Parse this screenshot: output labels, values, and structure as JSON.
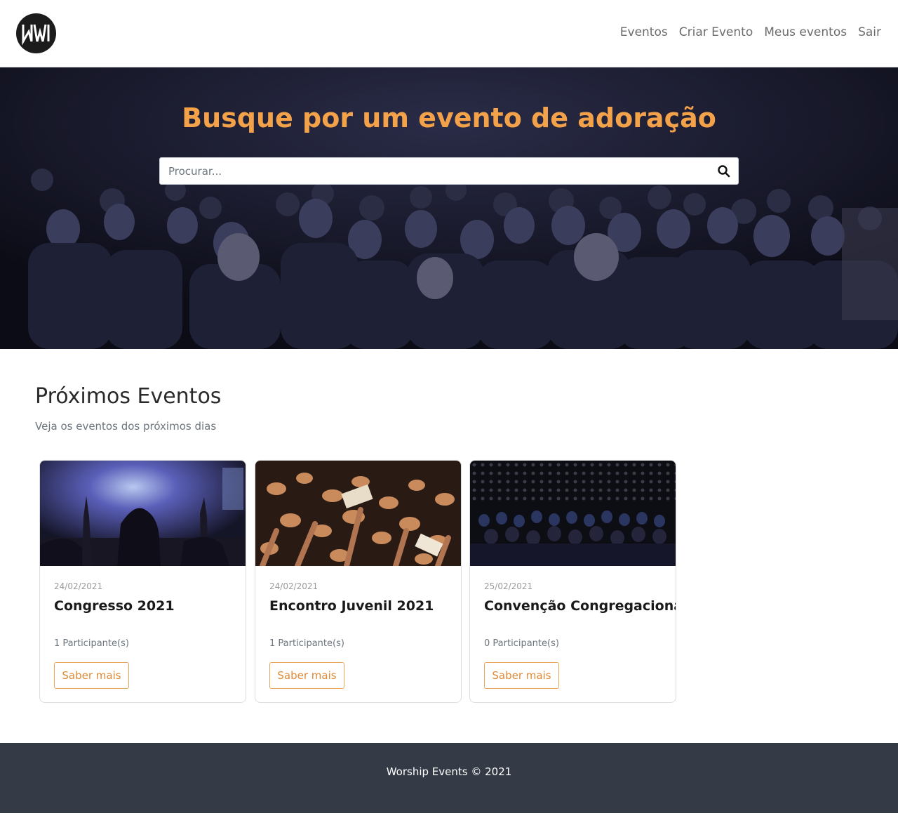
{
  "header": {
    "logo_text": "WW",
    "nav": [
      "Eventos",
      "Criar Evento",
      "Meus eventos",
      "Sair"
    ]
  },
  "hero": {
    "title": "Busque por um evento de adoração",
    "search_placeholder": "Procurar...",
    "search_value": ""
  },
  "section": {
    "title": "Próximos Eventos",
    "subtitle": "Veja os eventos dos próximos dias"
  },
  "events": [
    {
      "date": "24/02/2021",
      "title": "Congresso 2021",
      "participants": "1 Participante(s)",
      "button": "Saber mais"
    },
    {
      "date": "24/02/2021",
      "title": "Encontro Juvenil 2021",
      "participants": "1 Participante(s)",
      "button": "Saber mais"
    },
    {
      "date": "25/02/2021",
      "title": "Convenção Congregacional",
      "participants": "0 Participante(s)",
      "button": "Saber mais"
    }
  ],
  "footer": {
    "text": "Worship Events © 2021"
  },
  "colors": {
    "accent": "#f4a24a",
    "footer_bg": "#343a46",
    "button_border": "#e8a45a"
  },
  "icons": [
    "logo",
    "search-icon"
  ]
}
